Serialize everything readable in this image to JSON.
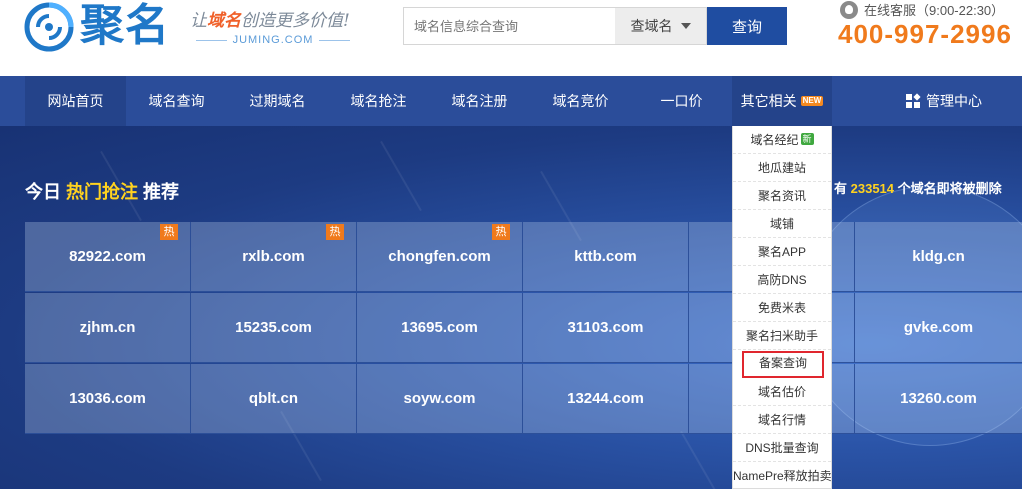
{
  "brand": {
    "logo_text": "聚名",
    "slogan_prefix": "让",
    "slogan_highlight": "域名",
    "slogan_suffix": "创造更多价值!",
    "domain": "JUMING.COM",
    "brand_color": "#1f78c8"
  },
  "search": {
    "placeholder": "域名信息综合查询",
    "select_value": "查域名",
    "button_label": "查询"
  },
  "service": {
    "label": "在线客服（9:00-22:30）",
    "phone": "400-997-2996",
    "icon": "headset-icon"
  },
  "nav": {
    "items": [
      {
        "label": "网站首页"
      },
      {
        "label": "域名查询"
      },
      {
        "label": "过期域名"
      },
      {
        "label": "域名抢注"
      },
      {
        "label": "域名注册"
      },
      {
        "label": "域名竞价"
      },
      {
        "label": "一口价"
      },
      {
        "label": "其它相关"
      }
    ],
    "new_badge": "NEW",
    "admin_label": "管理中心",
    "admin_icon": "grid-icon",
    "bg_color": "#2b4d9a"
  },
  "hero": {
    "title_prefix": "今日",
    "title_highlight": "热门抢注",
    "title_suffix": "推荐",
    "right_prefix": "有",
    "right_count": "233514",
    "right_suffix": "个域名即将被删除",
    "hot_label": "热",
    "rows": [
      [
        "82922.com",
        "rxlb.com",
        "chongfen.com",
        "kttb.com",
        "",
        "kldg.cn"
      ],
      [
        "zjhm.cn",
        "15235.com",
        "13695.com",
        "31103.com",
        "",
        "gvke.com"
      ],
      [
        "13036.com",
        "qblt.cn",
        "soyw.com",
        "13244.com",
        "",
        "13260.com"
      ]
    ]
  },
  "dropdown": {
    "items": [
      {
        "label": "域名经纪",
        "tag": "新"
      },
      {
        "label": "地瓜建站"
      },
      {
        "label": "聚名资讯"
      },
      {
        "label": "域铺"
      },
      {
        "label": "聚名APP"
      },
      {
        "label": "高防DNS"
      },
      {
        "label": "免费米表"
      },
      {
        "label": "聚名扫米助手"
      },
      {
        "label": "备案查询"
      },
      {
        "label": "域名估价"
      },
      {
        "label": "域名行情"
      },
      {
        "label": "DNS批量查询"
      },
      {
        "label": "NamePre释放拍卖"
      }
    ]
  }
}
